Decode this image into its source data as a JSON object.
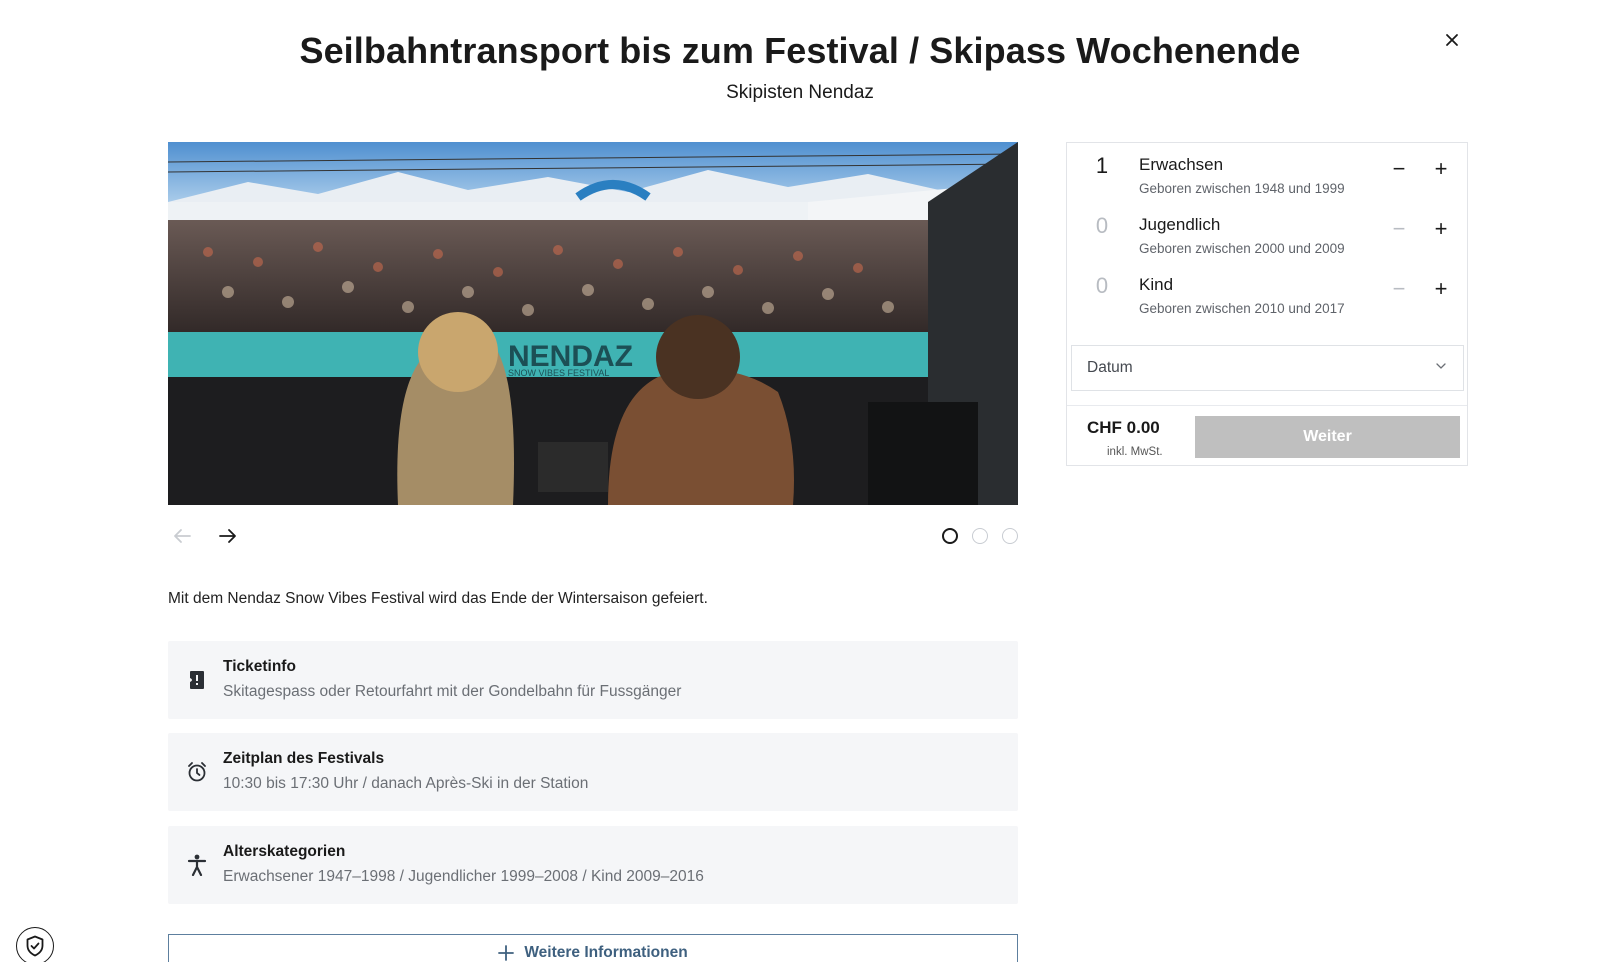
{
  "header": {
    "title": "Seilbahntransport bis zum Festival / Skipass Wochenende",
    "subtitle": "Skipisten Nendaz",
    "close_icon": "close-icon"
  },
  "gallery": {
    "image_alt": "Festival crowd in front of DJ stage at Nendaz",
    "banner_text": "NENDAZ",
    "banner_subtext": "SNOW VIBES FESTIVAL",
    "prev_icon": "arrow-left-icon",
    "next_icon": "arrow-right-icon",
    "slide_count": 3,
    "active_slide": 1
  },
  "description": "Mit dem Nendaz Snow Vibes Festival wird das Ende der Wintersaison gefeiert.",
  "info_cards": [
    {
      "icon": "ticket-icon",
      "title": "Ticketinfo",
      "text": "Skitagespass oder Retourfahrt mit der Gondelbahn für Fussgänger"
    },
    {
      "icon": "alarm-clock-icon",
      "title": "Zeitplan des Festivals",
      "text": "10:30 bis 17:30 Uhr / danach Après-Ski in der Station"
    },
    {
      "icon": "person-icon",
      "title": "Alterskategorien",
      "text": "Erwachsener 1947–1998 / Jugendlicher 1999–2008 / Kind 2009–2016"
    }
  ],
  "more_button": {
    "label": "Weitere Informationen",
    "icon": "plus-icon"
  },
  "booking": {
    "categories": [
      {
        "count": "1",
        "label": "Erwachsen",
        "sub": "Geboren zwischen 1948 und 1999"
      },
      {
        "count": "0",
        "label": "Jugendlich",
        "sub": "Geboren zwischen 2000 und 2009"
      },
      {
        "count": "0",
        "label": "Kind",
        "sub": "Geboren zwischen 2010 und 2017"
      }
    ],
    "minus_symbol": "−",
    "plus_symbol": "+",
    "date_placeholder": "Datum",
    "price": "CHF 0.00",
    "vat_note": "inkl. MwSt.",
    "submit_label": "Weiter"
  },
  "colors": {
    "accent_blue": "#3e607f",
    "button_disabled": "#bfbfbf",
    "card_bg": "#f5f6f8"
  },
  "privacy_icon": "shield-check-icon"
}
